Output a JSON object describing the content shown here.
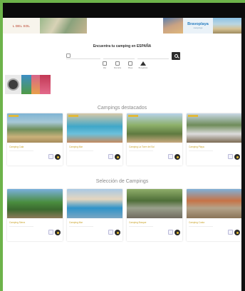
{
  "banners": {
    "left_logo_text": "L DEL SOL",
    "right_brand_title": "Bravoplaya",
    "right_brand_sub": "campings"
  },
  "search": {
    "title": "Encuentra tu camping en ESPAÑA",
    "fields": [
      "",
      "",
      ""
    ],
    "quick_links": [
      {
        "label": "Mar",
        "icon": "map-icon"
      },
      {
        "label": "Montaña",
        "icon": "mountain-icon"
      },
      {
        "label": "Playa",
        "icon": "beach-icon"
      },
      {
        "label": "Bungalows",
        "icon": "home-icon"
      }
    ]
  },
  "featured": {
    "title": "Campings destacados",
    "cards": [
      {
        "name": "Camping Cala",
        "sub": "",
        "image": "beach"
      },
      {
        "name": "Camping Mar",
        "sub": "",
        "image": "pool"
      },
      {
        "name": "Camping La Torre del Sol",
        "sub": "",
        "image": "palm"
      },
      {
        "name": "Camping Playa",
        "sub": "",
        "image": "camp"
      }
    ]
  },
  "selection": {
    "title": "Selección de Campings",
    "cards": [
      {
        "name": "Camping Sierra",
        "sub": "",
        "image": "flags"
      },
      {
        "name": "Camping Mar",
        "sub": "",
        "image": "pool"
      },
      {
        "name": "Camping Bosque",
        "sub": "",
        "image": "trees"
      },
      {
        "name": "Camping Costa",
        "sub": "",
        "image": "flags"
      }
    ]
  },
  "colors": {
    "accent_gold": "#c9a227",
    "frame_green": "#6db34a",
    "dark": "#2c2c2c"
  }
}
